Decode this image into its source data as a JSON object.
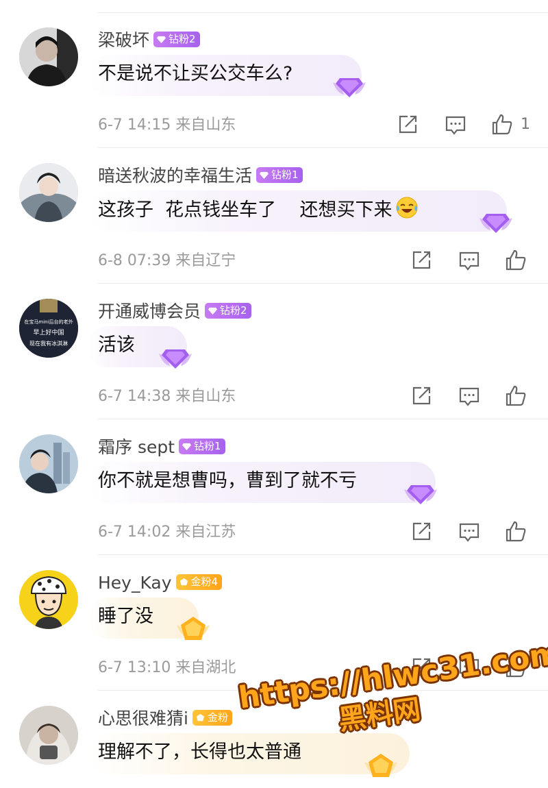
{
  "comments": [
    {
      "username": "梁破坏",
      "badge": {
        "type": "diamond",
        "label": "钻粉2"
      },
      "text": "不是说不让买公交车么?",
      "emoji": "",
      "time": "6-7 14:15",
      "location": "来自山东",
      "likes": "1",
      "avatar_icon": "avatar-man-dark-icon"
    },
    {
      "username": "暗送秋波的幸福生活",
      "badge": {
        "type": "diamond",
        "label": "钻粉1"
      },
      "text": "这孩子  花点钱坐车了    还想买下来",
      "emoji": "laughing-crying-emoji",
      "time": "6-8 07:39",
      "location": "来自辽宁",
      "likes": "",
      "avatar_icon": "avatar-costume-icon"
    },
    {
      "username": "开通威博会员",
      "badge": {
        "type": "diamond",
        "label": "钻粉2"
      },
      "text": "活该",
      "emoji": "",
      "time": "6-7 14:38",
      "location": "来自山东",
      "likes": "",
      "avatar_icon": "avatar-meme-icon",
      "avatar_text": [
        "在宝马mini后台的老外",
        "早上好中国",
        "现在我有冰淇淋"
      ]
    },
    {
      "username": "霜序 sept",
      "badge": {
        "type": "diamond",
        "label": "钻粉1"
      },
      "text": "你不就是想曹吗，曹到了就不亏",
      "emoji": "",
      "time": "6-7 14:02",
      "location": "来自江苏",
      "likes": "",
      "avatar_icon": "avatar-city-icon"
    },
    {
      "username": "Hey_Kay",
      "badge": {
        "type": "gold",
        "label": "金粉4"
      },
      "text": "睡了没",
      "emoji": "",
      "time": "6-7 13:10",
      "location": "来自湖北",
      "likes": "",
      "avatar_icon": "avatar-cartoon-icon"
    },
    {
      "username": "心思很难猜i",
      "badge": {
        "type": "gold",
        "label": "金粉"
      },
      "text": "理解不了，长得也太普通",
      "emoji": "",
      "time": "",
      "location": "",
      "likes": "",
      "avatar_icon": "avatar-hoodie-icon"
    }
  ],
  "icons": {
    "share": "share-icon",
    "comment": "comment-icon",
    "like": "thumbs-up-icon",
    "pendant_diamond": "diamond-pendant-icon",
    "pendant_gold": "gold-pendant-icon"
  },
  "watermark": {
    "url": "https://hlwc31.com",
    "brand": "黑料网"
  },
  "colors": {
    "diamond_badge": "#b06ef0",
    "gold_badge": "#ffb224",
    "meta_text": "#9a9a9a",
    "watermark": "#ffa51c"
  }
}
